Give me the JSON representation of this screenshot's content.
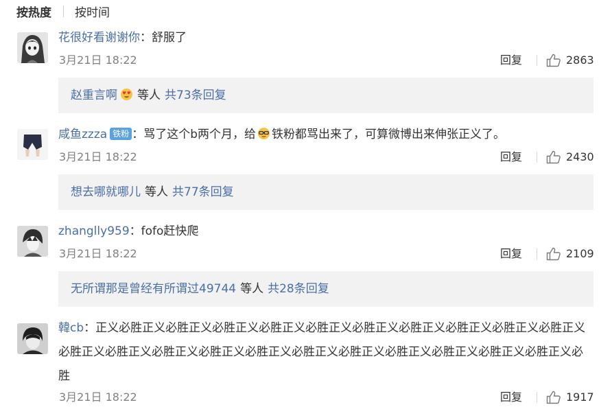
{
  "sort": {
    "active": "按热度",
    "other": "按时间"
  },
  "comments": [
    {
      "user": "花很好看谢谢你",
      "colon": "：",
      "text": "舒服了",
      "time": "3月21日 18:22",
      "reply_label": "回复",
      "likes": "2863",
      "replies": {
        "user": "赵重言啊",
        "mid": "等人",
        "count": "共73条回复"
      }
    },
    {
      "user": "咸鱼zzza",
      "badge": "铁粉",
      "colon": "：",
      "text_a": "骂了这个b两个月，给",
      "text_b": "铁粉都骂出来了，可算微博出来伸张正义了。",
      "time": "3月21日 18:22",
      "reply_label": "回复",
      "likes": "2430",
      "replies": {
        "user": "想去哪就哪儿",
        "mid": "等人",
        "count": "共77条回复"
      }
    },
    {
      "user": "zhanglly959",
      "colon": "：",
      "text": "fofo赶快爬",
      "time": "3月21日 18:22",
      "reply_label": "回复",
      "likes": "2109",
      "replies": {
        "user": "无所谓那是曾经有所谓过49744",
        "mid": "等人",
        "count": "共28条回复"
      }
    },
    {
      "user": "韓cb",
      "colon": "：",
      "text": "正义必胜正义必胜正义必胜正义必胜正义必胜正义必胜正义必胜正义必胜正义必胜正义必胜正义必胜正义必胜正义必胜正义必胜正义必胜正义必胜正义必胜正义必胜正义必胜正义必胜正义必胜正义必胜",
      "time": "3月21日 18:22",
      "reply_label": "回复",
      "likes": "1917"
    }
  ],
  "icons": {
    "like": "thumbs-up-icon",
    "emoji_1": "heart-eyes-emoji",
    "emoji_2": "glasses-face-emoji"
  },
  "colors": {
    "link": "#4a6ea8",
    "badge": "#5aa2dd",
    "reply_bg": "#f2f2f2",
    "time": "#808080"
  }
}
